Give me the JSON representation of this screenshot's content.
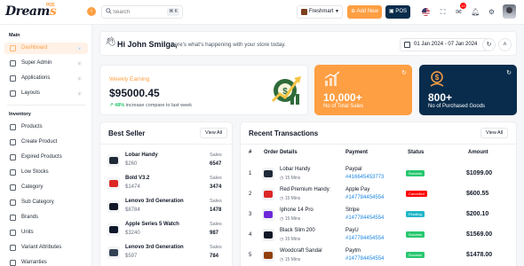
{
  "brand": {
    "name_part1": "Dream",
    "name_part2": "s",
    "badge": "POS",
    "accent": "#fe9f43",
    "navy": "#092c4c"
  },
  "topbar": {
    "search_placeholder": "Search",
    "search_shortcut": "⌘ K",
    "store": "Freshmart",
    "add_new": "Add New",
    "pos": "POS",
    "notification_count": "10"
  },
  "sidebar": {
    "main_title": "Main",
    "main_items": [
      {
        "label": "Dashboard",
        "icon": "grid-icon",
        "active": true
      },
      {
        "label": "Super Admin",
        "icon": "user-icon"
      },
      {
        "label": "Applications",
        "icon": "apps-icon"
      },
      {
        "label": "Layouts",
        "icon": "layout-icon"
      }
    ],
    "inventory_title": "Inventory",
    "inventory_items": [
      {
        "label": "Products",
        "icon": "box-icon"
      },
      {
        "label": "Create Product",
        "icon": "plus-box-icon"
      },
      {
        "label": "Expired Products",
        "icon": "clock-icon"
      },
      {
        "label": "Low Stocks",
        "icon": "trending-down-icon"
      },
      {
        "label": "Category",
        "icon": "category-icon"
      },
      {
        "label": "Sub Category",
        "icon": "subcategory-icon"
      },
      {
        "label": "Brands",
        "icon": "tag-icon"
      },
      {
        "label": "Units",
        "icon": "units-icon"
      },
      {
        "label": "Variant Attributes",
        "icon": "variant-icon"
      },
      {
        "label": "Warranties",
        "icon": "shield-icon"
      }
    ]
  },
  "welcome": {
    "greeting": "Hi John Smilga,",
    "subtitle": "here's what's happening with your store today.",
    "date_range": "01 Jan 2024 - 07 Jan 2024"
  },
  "weekly": {
    "label": "Weekly Earning",
    "value": "$95000.45",
    "percent": "48%",
    "compare": "increase compare to last week"
  },
  "stats": [
    {
      "value": "10,000+",
      "label": "No of Total Sales",
      "color": "#fe9f43"
    },
    {
      "value": "800+",
      "label": "No of Purchased Goods",
      "color": "#092c4c"
    }
  ],
  "best_seller": {
    "title": "Best Seller",
    "view_all": "View All",
    "sales_label": "Sales",
    "items": [
      {
        "name": "Lobar Handy",
        "price": "$260",
        "sales": "6547",
        "color": "#1f2937"
      },
      {
        "name": "Bold V3.2",
        "price": "$1474",
        "sales": "3474",
        "color": "#dc2626"
      },
      {
        "name": "Lenovo 3rd Generation",
        "price": "$8784",
        "sales": "1478",
        "color": "#111827"
      },
      {
        "name": "Apple Series 5 Watch",
        "price": "$3240",
        "sales": "987",
        "color": "#0f172a"
      },
      {
        "name": "Lenovo 3rd Generation",
        "price": "$597",
        "sales": "784",
        "color": "#334155"
      }
    ]
  },
  "transactions": {
    "title": "Recent Transactions",
    "view_all": "View All",
    "headers": [
      "#",
      "Order Details",
      "Payment",
      "Status",
      "Amount"
    ],
    "rows": [
      {
        "num": "1",
        "name": "Lobar Handy",
        "time": "15 Mins",
        "method": "Paypal",
        "id": "#416645453773",
        "status": "Success",
        "status_color": "#28c76f",
        "amount": "$1099.00",
        "color": "#1f2937"
      },
      {
        "num": "2",
        "name": "Red Premium Handy",
        "time": "15 Mins",
        "method": "Apple Pay",
        "id": "#147784454554",
        "status": "Cancelled",
        "status_color": "#ff0000",
        "amount": "$600.55",
        "color": "#dc2626"
      },
      {
        "num": "3",
        "name": "Iphone 14 Pro",
        "time": "15 Mins",
        "method": "Stripe",
        "id": "#147784454554",
        "status": "Pending",
        "status_color": "#1fb6c8",
        "amount": "$200.10",
        "color": "#6d28d9"
      },
      {
        "num": "4",
        "name": "Black Slim 200",
        "time": "15 Mins",
        "method": "PayU",
        "id": "#147784454554",
        "status": "Success",
        "status_color": "#28c76f",
        "amount": "$1569.00",
        "color": "#111827"
      },
      {
        "num": "5",
        "name": "Woodcraft Sandal",
        "time": "15 Mins",
        "method": "Paytm",
        "id": "#147784454554",
        "status": "Success",
        "status_color": "#28c76f",
        "amount": "$1478.00",
        "color": "#92400e"
      }
    ]
  }
}
